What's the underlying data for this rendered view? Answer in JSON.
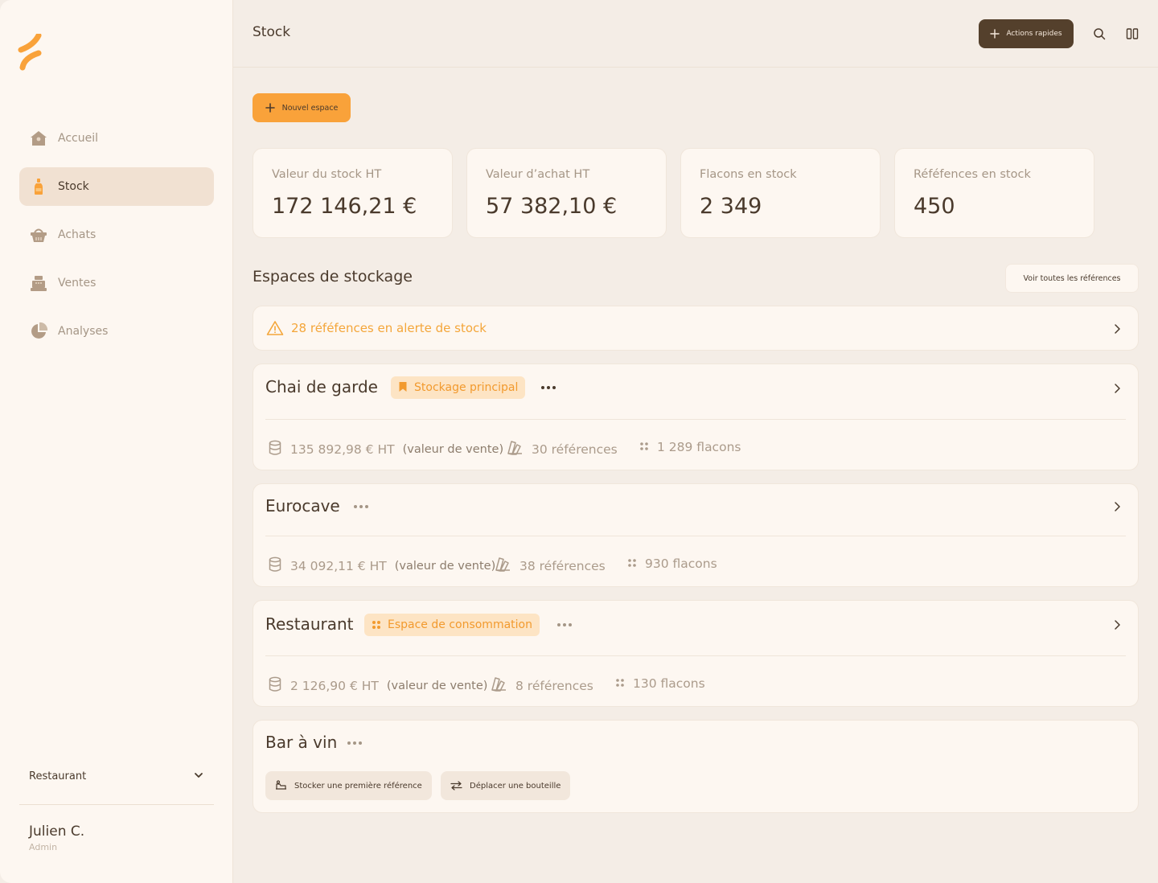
{
  "colors": {
    "accent": "#f9a23a",
    "dark_brown": "#54402c",
    "text": "#4a3a2c",
    "muted": "#a59686",
    "sidebar_bg": "#fdf7f1",
    "page_bg": "#f4ede6",
    "alert": "#f4a63a"
  },
  "sidebar": {
    "logo_icon": "brand-logo",
    "items": [
      {
        "label": "Accueil",
        "icon": "house-icon",
        "active": false
      },
      {
        "label": "Stock",
        "icon": "bottle-icon",
        "active": true
      },
      {
        "label": "Achats",
        "icon": "basket-icon",
        "active": false
      },
      {
        "label": "Ventes",
        "icon": "cash-register-icon",
        "active": false
      },
      {
        "label": "Analyses",
        "icon": "pie-chart-icon",
        "active": false
      }
    ],
    "space_selector": {
      "value": "Restaurant"
    },
    "user": {
      "name": "Julien C.",
      "role": "Admin"
    }
  },
  "header": {
    "title": "Stock",
    "quick_actions_label": "Actions rapides"
  },
  "main": {
    "new_space_label": "Nouvel espace",
    "kpis": [
      {
        "label": "Valeur du stock HT",
        "value": "172 146,21 €"
      },
      {
        "label": "Valeur d’achat HT",
        "value": "57 382,10 €"
      },
      {
        "label": "Flacons en stock",
        "value": "2 349"
      },
      {
        "label": "Réfé­fences en stock",
        "value": "450"
      }
    ],
    "section_title": "Espaces de stockage",
    "see_all_label": "Voir toutes les références",
    "alert_text": "28 réfé­fences en alerte de stock",
    "spaces": [
      {
        "name": "Chai de garde",
        "badge": "Stockage principal",
        "value": "135 892,98 € HT",
        "value_note": "(valeur de vente)",
        "references": "30 références",
        "bottles": "1 289 flacons"
      },
      {
        "name": "Eurocave",
        "badge": "",
        "value": "34 092,11 € HT",
        "value_note": "(valeur de vente)",
        "references": "38 références",
        "bottles": "930 flacons"
      },
      {
        "name": "Restaurant",
        "badge": "Espace de consommation",
        "value": "2 126,90 € HT",
        "value_note": "(valeur de vente)",
        "references": "8 références",
        "bottles": "130 flacons"
      },
      {
        "name": "Bar à vin",
        "badge": "",
        "store_first_label": "Stocker une première référence",
        "move_bottle_label": "Déplacer une bouteille"
      }
    ]
  }
}
